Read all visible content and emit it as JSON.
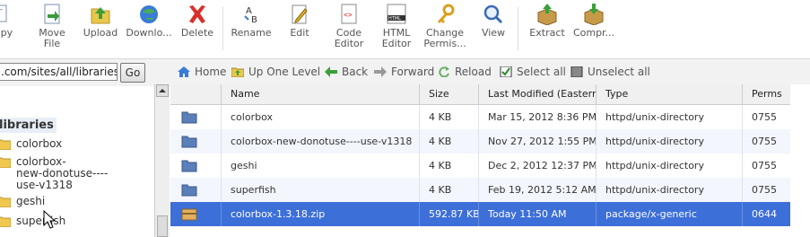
{
  "toolbar": {
    "buttons": [
      {
        "label": "opy",
        "icon": "copy-icon"
      },
      {
        "label": "Move\nFile",
        "icon": "move-file-icon"
      },
      {
        "label": "Upload",
        "icon": "upload-icon"
      },
      {
        "label": "Downlo...",
        "icon": "download-icon"
      },
      {
        "label": "Delete",
        "icon": "delete-icon"
      },
      {
        "label": "Rename",
        "icon": "rename-icon"
      },
      {
        "label": "Edit",
        "icon": "edit-icon"
      },
      {
        "label": "Code\nEditor",
        "icon": "code-editor-icon"
      },
      {
        "label": "HTML\nEditor",
        "icon": "html-editor-icon"
      },
      {
        "label": "Change\nPermis...",
        "icon": "change-permissions-icon"
      },
      {
        "label": "View",
        "icon": "view-icon"
      },
      {
        "label": "Extract",
        "icon": "extract-icon"
      },
      {
        "label": "Compr...",
        "icon": "compress-icon"
      }
    ]
  },
  "path": {
    "value": ".com/sites/all/libraries",
    "go_label": "Go"
  },
  "nav": {
    "home": "Home",
    "up": "Up One Level",
    "back": "Back",
    "forward": "Forward",
    "reload": "Reload",
    "select_all": "Select all",
    "unselect_all": "Unselect all"
  },
  "tree": {
    "root": "libraries",
    "items": [
      {
        "label": "colorbox"
      },
      {
        "label": "colorbox-\nnew-donotuse----\nuse-v1318"
      },
      {
        "label": "geshi"
      },
      {
        "label": "superfish"
      }
    ]
  },
  "table": {
    "headers": [
      "Name",
      "Size",
      "Last Modified (Eastern St",
      "Type",
      "Perms"
    ],
    "rows": [
      {
        "name": "colorbox",
        "size": "4 KB",
        "modified": "Mar 15, 2012 8:36 PM",
        "type": "httpd/unix-directory",
        "perms": "0755",
        "kind": "folder"
      },
      {
        "name": "colorbox-new-donotuse----use-v1318",
        "size": "4 KB",
        "modified": "Nov 27, 2012 1:55 PM",
        "type": "httpd/unix-directory",
        "perms": "0755",
        "kind": "folder"
      },
      {
        "name": "geshi",
        "size": "4 KB",
        "modified": "Dec 2, 2012 12:37 PM",
        "type": "httpd/unix-directory",
        "perms": "0755",
        "kind": "folder"
      },
      {
        "name": "superfish",
        "size": "4 KB",
        "modified": "Feb 19, 2012 5:12 AM",
        "type": "httpd/unix-directory",
        "perms": "0755",
        "kind": "folder"
      },
      {
        "name": "colorbox-1.3.18.zip",
        "size": "592.87 KB",
        "modified": "Today 11:50 AM",
        "type": "package/x-generic",
        "perms": "0644",
        "kind": "archive",
        "selected": true
      }
    ]
  },
  "colors": {
    "selection": "#3d6fd9",
    "folder": "#5b7fb8"
  }
}
